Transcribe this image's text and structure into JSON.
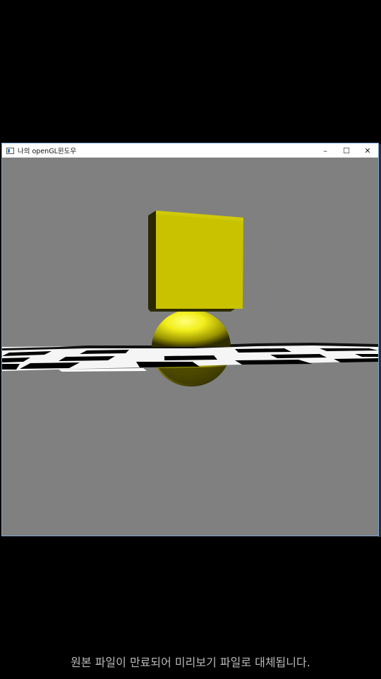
{
  "window": {
    "title": "나의 openGL윈도우",
    "controls": {
      "minimize": "–",
      "maximize": "☐",
      "close": "✕"
    }
  },
  "scene": {
    "background_color": "#808080",
    "cube_color": "#c9c200",
    "sphere_color": "#f2ee1a",
    "floor_dark": "#000000",
    "floor_light": "#ffffff"
  },
  "caption": "원본 파일이 만료되어 미리보기 파일로 대체됩니다."
}
